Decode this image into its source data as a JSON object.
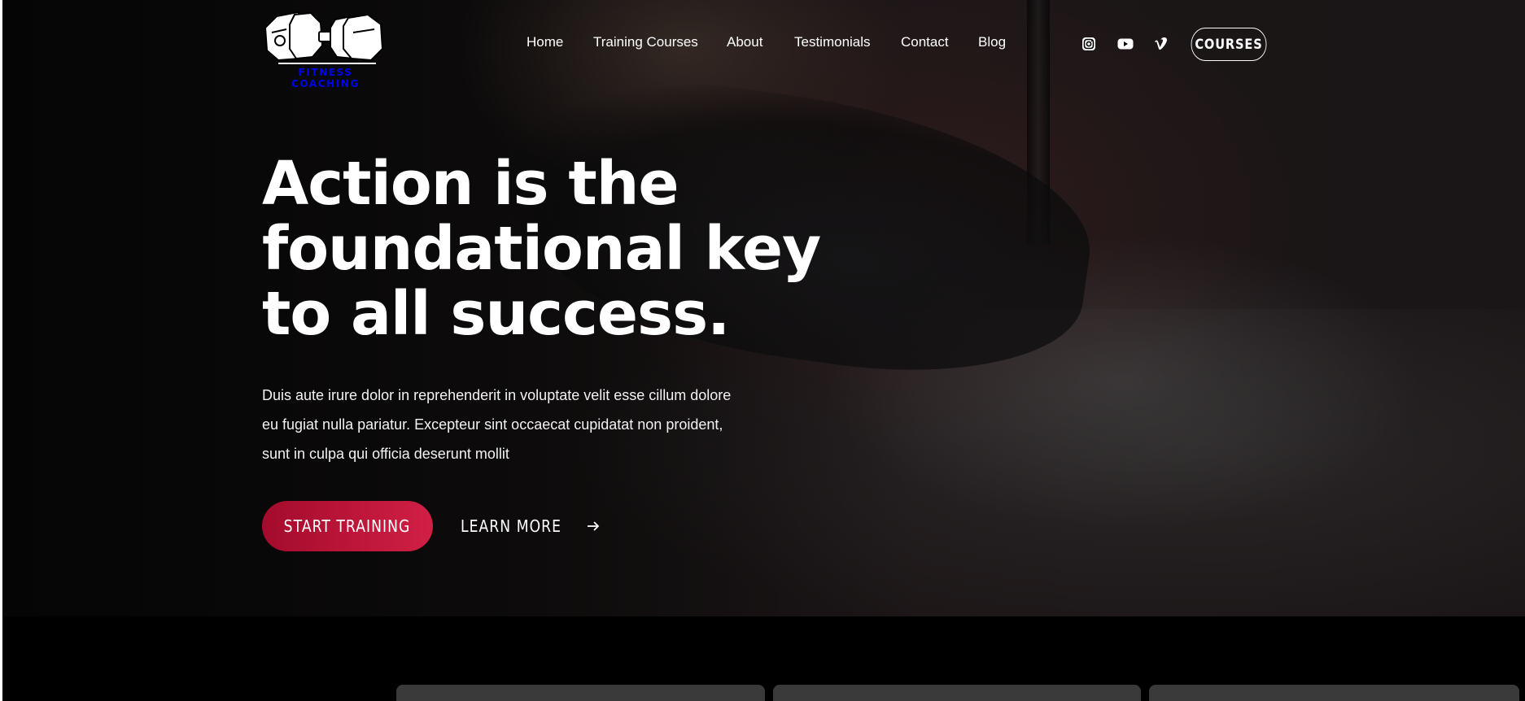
{
  "brand": {
    "logo_text": "FITNESS COACHING",
    "logo_icon": "dumbbell-icon"
  },
  "nav": {
    "items": [
      {
        "label": "Home"
      },
      {
        "label": "Training Courses"
      },
      {
        "label": "About"
      },
      {
        "label": "Testimonials"
      },
      {
        "label": "Contact"
      },
      {
        "label": "Blog"
      }
    ]
  },
  "social": [
    {
      "icon": "instagram-icon"
    },
    {
      "icon": "youtube-icon"
    },
    {
      "icon": "vimeo-icon"
    }
  ],
  "header_button": {
    "label": "COURSES"
  },
  "hero": {
    "headline_lines": [
      "Action is the",
      "foundational key",
      "to all success."
    ],
    "lead_lines": [
      "Duis aute irure dolor in reprehenderit in voluptate velit esse cillum dolore",
      "eu fugiat nulla pariatur. Excepteur sint occaecat cupidatat non proident,",
      "sunt in culpa qui officia deserunt mollit"
    ],
    "primary_cta": "START TRAINING",
    "secondary_cta": "LEARN MORE",
    "secondary_cta_icon": "arrow-right-icon"
  },
  "colors": {
    "accent_start": "#a30b2c",
    "accent_end": "#d11f45",
    "background": "#000000",
    "text": "#ffffff"
  }
}
